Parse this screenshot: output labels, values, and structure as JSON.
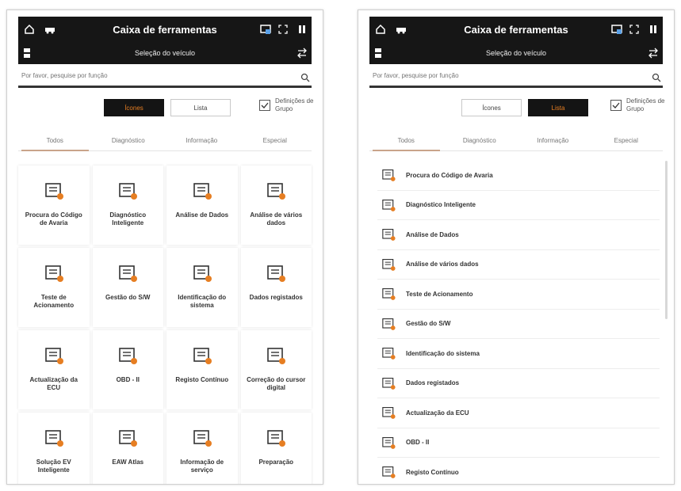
{
  "screens": {
    "left": {
      "title": "Caixa de ferramentas",
      "subtitle": "Seleção do veículo",
      "search_placeholder": "Por favor, pesquise por função",
      "view_icons": "Ícones",
      "view_list": "Lista",
      "active_view": "icons",
      "group_settings": "Definições de Grupo",
      "tabs": [
        "Todos",
        "Diagnóstico",
        "Informação",
        "Especial"
      ],
      "items": [
        {
          "label": "Procura do Código de Avaria",
          "icon": "barcode-search-icon"
        },
        {
          "label": "Diagnóstico Inteligente",
          "icon": "smart-diagnosis-icon"
        },
        {
          "label": "Análise de Dados",
          "icon": "data-analysis-icon"
        },
        {
          "label": "Análise de vários dados",
          "icon": "multi-data-icon"
        },
        {
          "label": "Teste de Acionamento",
          "icon": "actuation-test-icon"
        },
        {
          "label": "Gestão do S/W",
          "icon": "software-icon"
        },
        {
          "label": "Identificação do sistema",
          "icon": "system-id-icon"
        },
        {
          "label": "Dados registados",
          "icon": "recorded-data-icon"
        },
        {
          "label": "Actualização da ECU",
          "icon": "ecu-update-icon"
        },
        {
          "label": "OBD - II",
          "icon": "obd-icon"
        },
        {
          "label": "Registo Contínuo",
          "icon": "continuous-log-icon"
        },
        {
          "label": "Correção do cursor digital",
          "icon": "cursor-correction-icon"
        },
        {
          "label": "Solução EV Inteligente",
          "icon": "ev-solution-icon"
        },
        {
          "label": "EAW Atlas",
          "icon": "globe-icon"
        },
        {
          "label": "Informação de serviço",
          "icon": "service-info-icon"
        },
        {
          "label": "Preparação",
          "icon": "preparation-icon"
        }
      ]
    },
    "right": {
      "title": "Caixa de ferramentas",
      "subtitle": "Seleção do veículo",
      "search_placeholder": "Por favor, pesquise por função",
      "view_icons": "Ícones",
      "view_list": "Lista",
      "active_view": "list",
      "group_settings": "Definições de Grupo",
      "tabs": [
        "Todos",
        "Diagnóstico",
        "Informação",
        "Especial"
      ],
      "items": [
        {
          "label": "Procura do Código de Avaria",
          "icon": "barcode-search-icon"
        },
        {
          "label": "Diagnóstico Inteligente",
          "icon": "smart-diagnosis-icon"
        },
        {
          "label": "Análise de Dados",
          "icon": "data-analysis-icon"
        },
        {
          "label": "Análise de vários dados",
          "icon": "multi-data-icon"
        },
        {
          "label": "Teste de Acionamento",
          "icon": "actuation-test-icon"
        },
        {
          "label": "Gestão do S/W",
          "icon": "software-icon"
        },
        {
          "label": "Identificação do sistema",
          "icon": "system-id-icon"
        },
        {
          "label": "Dados registados",
          "icon": "recorded-data-icon"
        },
        {
          "label": "Actualização da ECU",
          "icon": "ecu-update-icon"
        },
        {
          "label": "OBD - II",
          "icon": "obd-icon"
        },
        {
          "label": "Registo Contínuo",
          "icon": "continuous-log-icon"
        }
      ]
    }
  },
  "colors": {
    "accent": "#e67e22",
    "dark_bar": "#161616",
    "tab_underline": "#c9a48a"
  }
}
